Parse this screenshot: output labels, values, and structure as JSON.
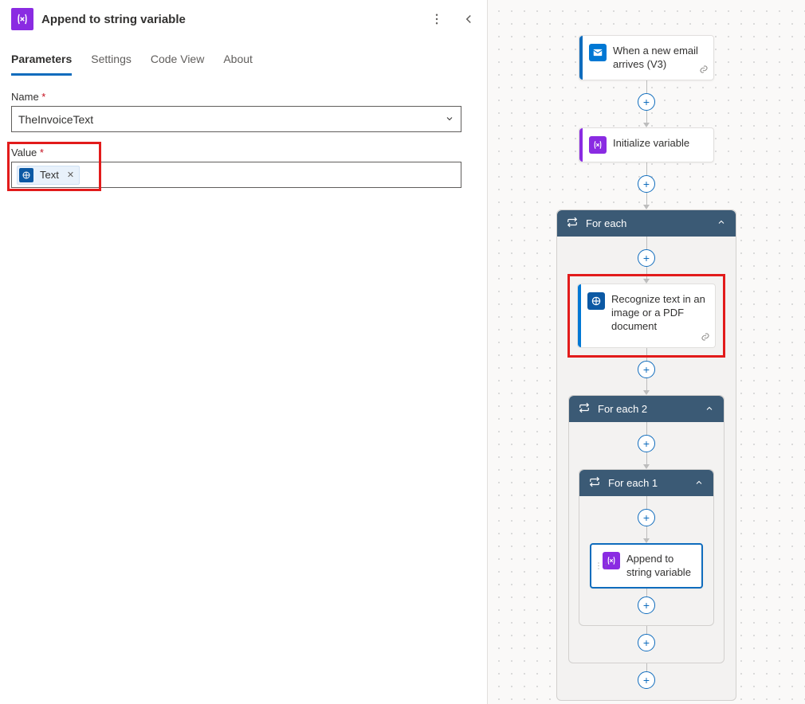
{
  "header": {
    "title": "Append to string variable"
  },
  "tabs": {
    "parameters": "Parameters",
    "settings": "Settings",
    "code_view": "Code View",
    "about": "About"
  },
  "form": {
    "name_label": "Name",
    "name_value": "TheInvoiceText",
    "value_label": "Value",
    "token_text": "Text"
  },
  "flow": {
    "email": "When a new email arrives (V3)",
    "init_var": "Initialize variable",
    "for_each": "For each",
    "ocr": "Recognize text in an image or a PDF document",
    "for_each_2": "For each 2",
    "for_each_1": "For each 1",
    "append": "Append to string variable"
  }
}
